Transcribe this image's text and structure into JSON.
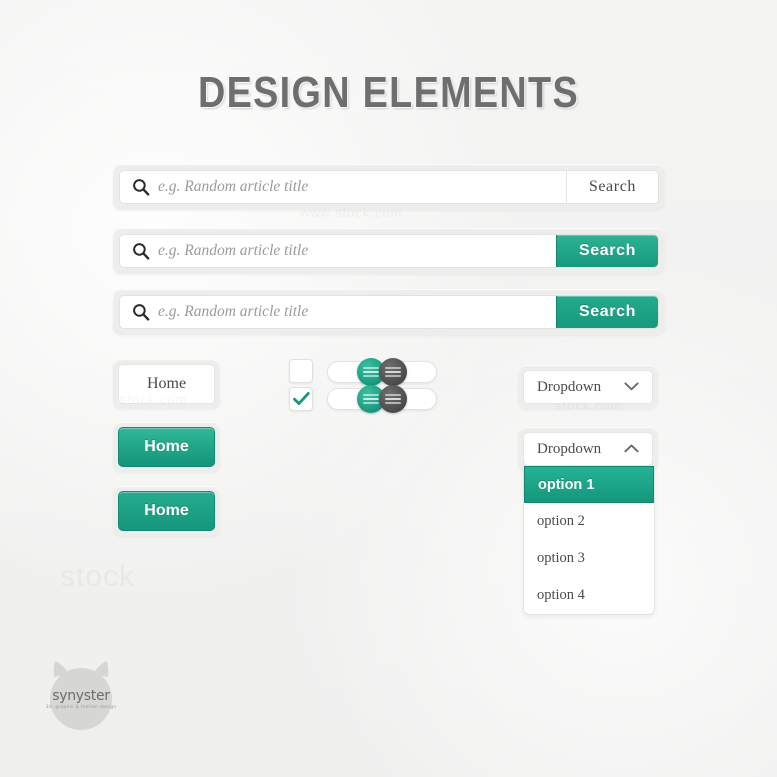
{
  "page": {
    "title": "DESIGN ELEMENTS",
    "background_color": "#f2f2f1",
    "accent_color": "#1a9c80",
    "text_color": "#4b4b4b"
  },
  "search_bars": [
    {
      "id": "search-bar-plain",
      "icon": "search-icon",
      "placeholder": "e.g. Random article title",
      "value": "",
      "button_label": "Search",
      "button_style": "plain"
    },
    {
      "id": "search-bar-teal",
      "icon": "search-icon",
      "placeholder": "e.g. Random article title",
      "value": "",
      "button_label": "Search",
      "button_style": "teal"
    },
    {
      "id": "search-bar-teal-flat",
      "icon": "search-icon",
      "placeholder": "e.g. Random article title",
      "value": "",
      "button_label": "Search",
      "button_style": "teal-flat"
    }
  ],
  "buttons": [
    {
      "id": "home-button-white",
      "label": "Home",
      "style": "white"
    },
    {
      "id": "home-button-teal",
      "label": "Home",
      "style": "teal"
    },
    {
      "id": "home-button-teal-flat",
      "label": "Home",
      "style": "teal-flat"
    }
  ],
  "checkboxes": [
    {
      "id": "checkbox-unchecked",
      "checked": false,
      "icon": "checkbox-empty-icon"
    },
    {
      "id": "checkbox-checked",
      "checked": true,
      "icon": "check-icon"
    }
  ],
  "toggles": [
    {
      "id": "toggle-teal-on-top",
      "state": "on",
      "knob_color": "#16987c",
      "knob_side": "right"
    },
    {
      "id": "toggle-teal-on-bottom",
      "state": "on",
      "knob_color": "#16987c",
      "knob_side": "right"
    },
    {
      "id": "toggle-dark-off-top",
      "state": "off",
      "knob_color": "#4a4a4a",
      "knob_side": "left"
    },
    {
      "id": "toggle-dark-off-bottom",
      "state": "off",
      "knob_color": "#4a4a4a",
      "knob_side": "left"
    }
  ],
  "dropdown_closed": {
    "label": "Dropdown",
    "icon": "chevron-down-icon",
    "expanded": false
  },
  "dropdown_open": {
    "label": "Dropdown",
    "icon": "chevron-up-icon",
    "expanded": true,
    "selected": "option 1",
    "options": [
      "option 1",
      "option 2",
      "option 3",
      "option 4"
    ]
  },
  "logo": {
    "name": "synyster",
    "tagline": "3d, graphic & motion design"
  }
}
